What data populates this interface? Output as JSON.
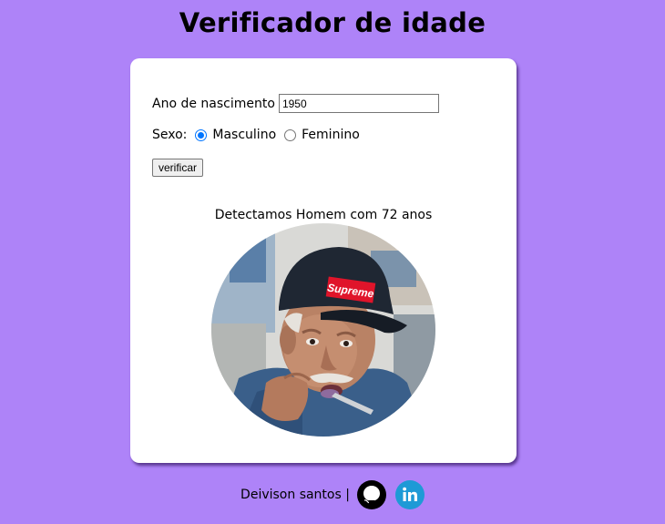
{
  "title": "Verificador de idade",
  "form": {
    "year_label": "Ano de nascimento",
    "year_value": "1950",
    "sex_label": "Sexo:",
    "options": [
      {
        "label": "Masculino",
        "checked": true
      },
      {
        "label": "Feminino",
        "checked": false
      }
    ],
    "button_label": "verificar"
  },
  "result": {
    "text": "Detectamos Homem com 72 anos",
    "image_icon": "elderly-man-photo"
  },
  "footer": {
    "author": "Deivison santos |",
    "icons": [
      "github-icon",
      "linkedin-icon"
    ]
  },
  "colors": {
    "background": "#ae83f8",
    "card": "#ffffff",
    "radio_accent": "#0075ff",
    "linkedin": "#1e9ad6"
  }
}
